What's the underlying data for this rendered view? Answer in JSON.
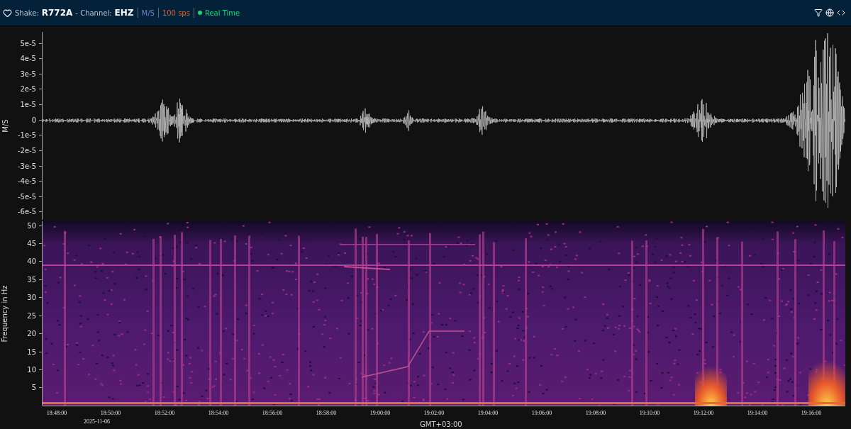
{
  "header": {
    "station_label": "Shake:",
    "station": "R772A",
    "channel_label": "- Channel:",
    "channel": "EHZ",
    "units": "M/S",
    "rate": "100 sps",
    "status": "Real Time",
    "live": true
  },
  "waveform": {
    "ylabel": "M/S",
    "yticks": [
      "5e-5",
      "4e-5",
      "3e-5",
      "2e-5",
      "1e-5",
      "0",
      "-1e-5",
      "-2e-5",
      "-3e-5",
      "-4e-5",
      "-5e-5",
      "-6e-5"
    ]
  },
  "spectrogram": {
    "ylabel": "Frequency in Hz",
    "yticks": [
      "50",
      "45",
      "40",
      "35",
      "30",
      "25",
      "20",
      "15",
      "10",
      "5"
    ]
  },
  "time_axis": {
    "ticks": [
      "18:48:00",
      "18:50:00",
      "18:52:00",
      "18:54:00",
      "18:56:00",
      "18:58:00",
      "19:00:00",
      "19:02:00",
      "19:04:00",
      "19:06:00",
      "19:08:00",
      "19:10:00",
      "19:12:00",
      "19:14:00",
      "19:16:00"
    ],
    "date": "2025-11-06",
    "timezone": "GMT+03:00"
  }
}
